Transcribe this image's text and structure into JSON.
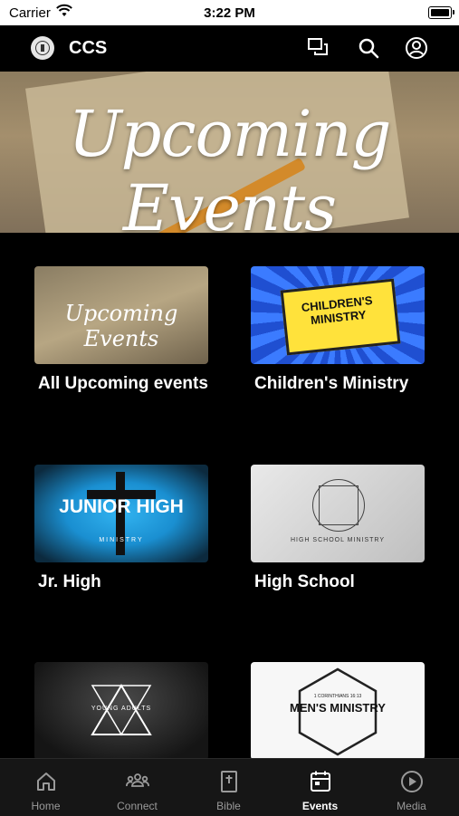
{
  "status_bar": {
    "carrier": "Carrier",
    "time": "3:22 PM"
  },
  "nav": {
    "title": "CCS",
    "icons": [
      "chat-icon",
      "search-icon",
      "account-icon"
    ]
  },
  "hero": {
    "title": "Upcoming Events"
  },
  "cards": [
    {
      "label": "All Upcoming events",
      "thumb_text": "Upcoming Events"
    },
    {
      "label": "Children's Ministry",
      "thumb_text": "CHILDREN'S MINISTRY"
    },
    {
      "label": "Jr. High",
      "thumb_text": "JUNIOR HIGH",
      "thumb_subtext": "MINISTRY"
    },
    {
      "label": "High School",
      "thumb_text": "HIGH SCHOOL MINISTRY"
    },
    {
      "label": "",
      "thumb_text": "YOUNG ADULTS"
    },
    {
      "label": "",
      "thumb_text": "MEN'S MINISTRY",
      "thumb_subtext": "1 CORINTHIANS 16:13"
    }
  ],
  "tabs": [
    {
      "label": "Home",
      "icon": "home-icon"
    },
    {
      "label": "Connect",
      "icon": "people-icon"
    },
    {
      "label": "Bible",
      "icon": "bible-icon"
    },
    {
      "label": "Events",
      "icon": "calendar-icon",
      "active": true
    },
    {
      "label": "Media",
      "icon": "play-icon"
    }
  ],
  "colors": {
    "background": "#000000",
    "tabbar": "#161616",
    "active_tab": "#ffffff",
    "inactive_tab": "#9a9a9a"
  }
}
